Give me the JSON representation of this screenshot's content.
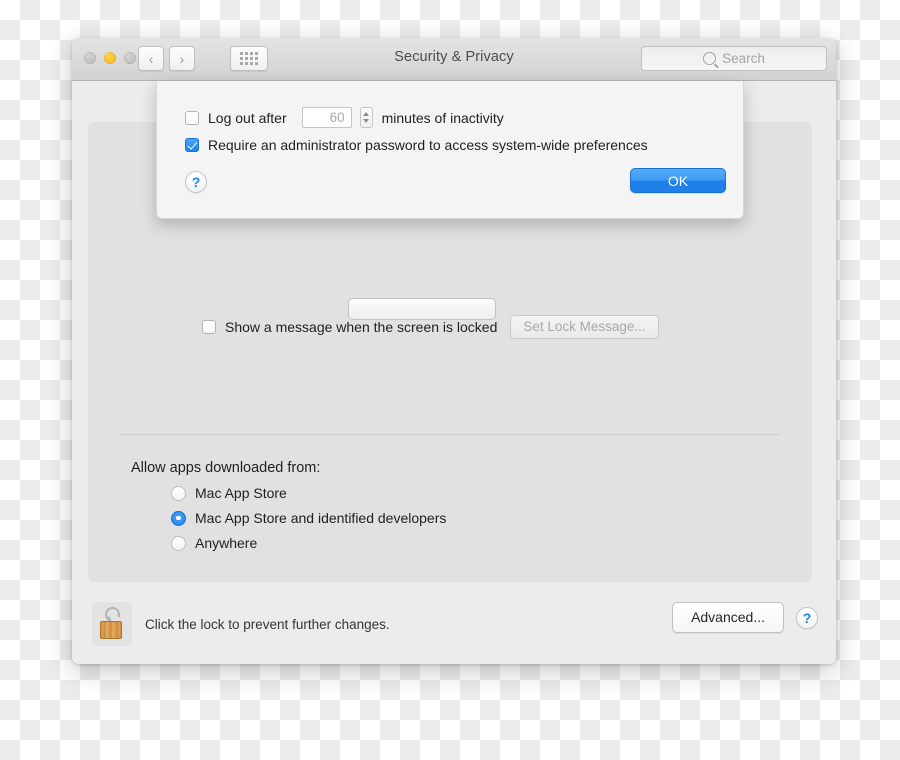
{
  "window": {
    "title": "Security & Privacy",
    "traffic_lights": [
      "close",
      "minimize",
      "zoom"
    ],
    "toolbar": {
      "back_label": "‹",
      "forward_label": "›",
      "show_all_label": "show-all-grid"
    },
    "search": {
      "placeholder": "Search",
      "value": ""
    }
  },
  "sheet": {
    "log_out_after": {
      "label": "Log out after",
      "checked": false,
      "minutes_value": "60",
      "suffix_label": "minutes of inactivity"
    },
    "require_password": {
      "label": "Require an administrator password to access system-wide preferences",
      "checked": true
    },
    "help_label": "?",
    "ok_label": "OK"
  },
  "main": {
    "lock_message": {
      "label": "Show a message when the screen is locked",
      "checked": false,
      "button_label": "Set Lock Message...",
      "button_enabled": false
    },
    "gatekeeper": {
      "title": "Allow apps downloaded from:",
      "options": [
        {
          "label": "Mac App Store",
          "selected": false
        },
        {
          "label": "Mac App Store and identified developers",
          "selected": true
        },
        {
          "label": "Anywhere",
          "selected": false
        }
      ]
    }
  },
  "footer": {
    "lock_icon": "open-padlock-icon",
    "lock_text": "Click the lock to prevent further changes.",
    "advanced_label": "Advanced...",
    "help_label": "?"
  },
  "colors": {
    "accent_blue": "#1e80e8",
    "window_bg": "#ececec",
    "pane_bg": "#e2e1e1",
    "sheet_bg": "#f4f4f4"
  }
}
